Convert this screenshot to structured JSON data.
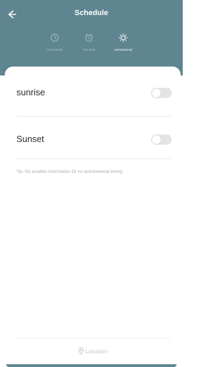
{
  "header": {
    "title": "Schedule",
    "background_color": "#5e8590"
  },
  "tabs": [
    {
      "label": "Countdown",
      "icon": "clock-icon",
      "active": false
    },
    {
      "label": "Schedule",
      "icon": "alarm-icon",
      "active": false
    },
    {
      "label": "Astronomical",
      "icon": "sun-icon",
      "active": true
    }
  ],
  "rows": [
    {
      "label": "sunrise",
      "enabled": false
    },
    {
      "label": "Sunset",
      "enabled": false
    }
  ],
  "tip": "Tip: No location information Or no astronomical timing",
  "location_button": {
    "label": "Location",
    "icon": "location-pin-icon"
  }
}
